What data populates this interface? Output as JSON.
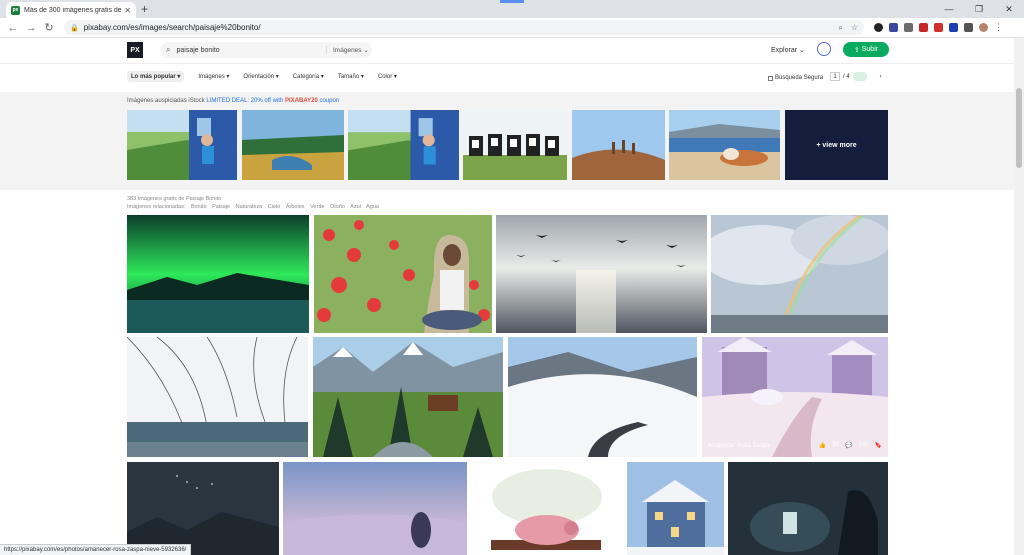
{
  "browser": {
    "tab_title": "Más de 300 imágenes gratis de P...",
    "url": "pixabay.com/es/images/search/paisaje%20bonito/",
    "status_url": "https://pixabay.com/es/photos/amanecer-rosa-zaspa-nieve-5932636/"
  },
  "header": {
    "logo": "PX",
    "search_value": "paisaje bonito",
    "search_type": "Imágenes",
    "explore": "Explorar",
    "upload": "Subir"
  },
  "filters": {
    "items": [
      "Lo más popular",
      "Imágenes",
      "Orientación",
      "Categoría",
      "Tamaño",
      "Color"
    ],
    "safe_search": "Búsqueda Segura",
    "page_current": "1",
    "page_total": "/ 4"
  },
  "sponsored": {
    "label_prefix": "Imágenes auspiciadas iStock",
    "promo": "LIMITED DEAL: 20% off with",
    "code": "PIXABAY20",
    "suffix": "coupon",
    "view_more": "+ view more"
  },
  "results": {
    "count_text": "383 Imágenes gratis de Paisaje Bonito",
    "related_label": "Imágenes relacionadas:",
    "related": [
      "Bonito",
      "Paisaje",
      "Naturaleza",
      "Cielo",
      "Árboles",
      "Verde",
      "Otoño",
      "Azul",
      "Agua"
    ],
    "hover_title": "Amanecer Rosa  Zaspa",
    "hover_likes": "95",
    "hover_comments": "140"
  },
  "colors": {
    "brand_green": "#0aab5e",
    "promo_blue": "#1d6fdc",
    "promo_red": "#e24b3b"
  }
}
